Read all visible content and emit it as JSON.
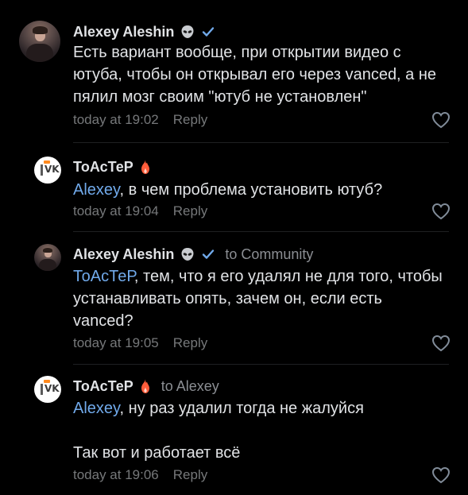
{
  "comments": [
    {
      "author": "Alexey Aleshin",
      "reply_to": "",
      "mention": "",
      "text": "Есть вариант вообще, при открытии видео с ютуба, чтобы он открывал его через vanced, а не пялил мозг своим \"ютуб не установлен\"",
      "time": "today at 19:02",
      "reply_label": "Reply",
      "avatar": "user-photo",
      "badges": [
        "alien-icon",
        "verified-check-icon"
      ]
    },
    {
      "author": "ТоАсТеР",
      "reply_to": "",
      "mention": "Alexey",
      "text": ", в чем проблема установить ютуб?",
      "time": "today at 19:04",
      "reply_label": "Reply",
      "avatar": "vk-logo",
      "badges": [
        "fire-icon"
      ]
    },
    {
      "author": "Alexey Aleshin",
      "reply_to": "to Community",
      "mention": "ТоАсТеР",
      "text": ", тем, что я его удалял не для того, чтобы устанавливать опять, зачем он, если есть vanced?",
      "time": "today at 19:05",
      "reply_label": "Reply",
      "avatar": "user-photo",
      "badges": [
        "alien-icon",
        "verified-check-icon"
      ]
    },
    {
      "author": "ТоАсТеР",
      "reply_to": "to Alexey",
      "mention": "Alexey",
      "text": ", ну раз удалил тогда не жалуйся\n\nТак вот и работает всё",
      "time": "today at 19:06",
      "reply_label": "Reply",
      "avatar": "vk-logo",
      "badges": [
        "fire-icon"
      ]
    }
  ],
  "avatar_vk_text": "VK",
  "colors": {
    "background": "#000000",
    "text": "#e1e3e6",
    "muted": "#76787a",
    "mention": "#71aaeb",
    "verified": "#71aaeb",
    "fire": "#ff5c3a"
  }
}
